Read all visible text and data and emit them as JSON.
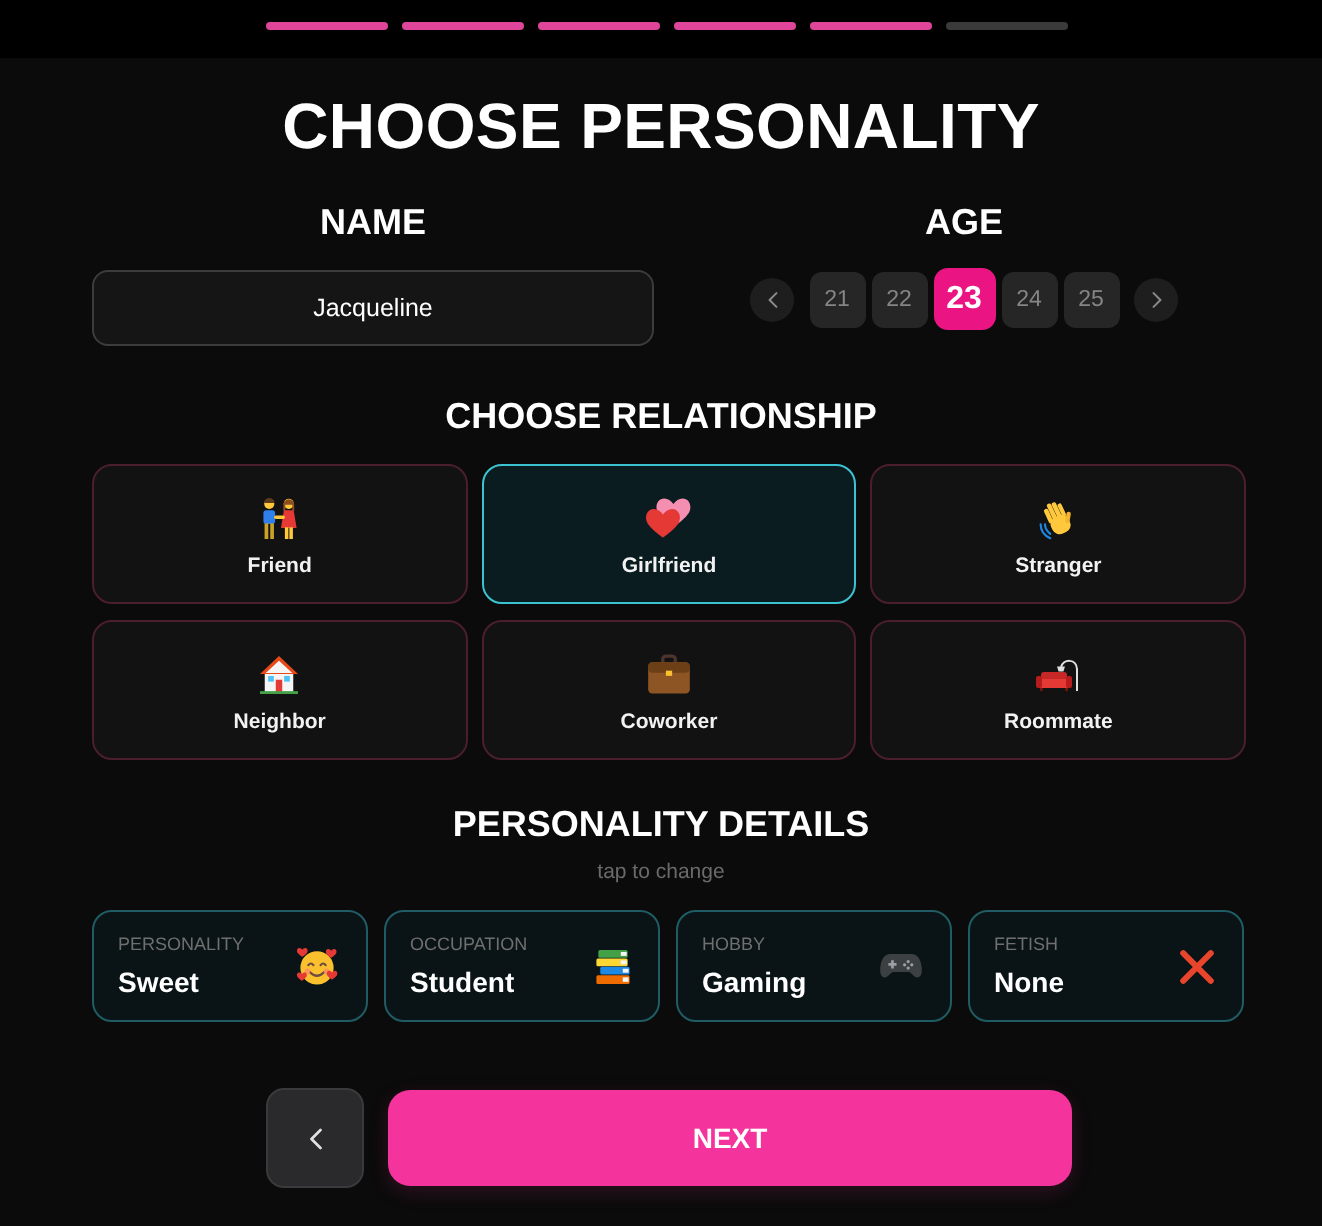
{
  "progress": {
    "steps": [
      {
        "completed": true
      },
      {
        "completed": true
      },
      {
        "completed": true
      },
      {
        "completed": true
      },
      {
        "completed": true
      },
      {
        "completed": false
      }
    ]
  },
  "title": "CHOOSE PERSONALITY",
  "name": {
    "label": "NAME",
    "value": "Jacqueline"
  },
  "age": {
    "label": "AGE",
    "options": [
      {
        "label": "21",
        "selected": false
      },
      {
        "label": "22",
        "selected": false
      },
      {
        "label": "23",
        "selected": true
      },
      {
        "label": "24",
        "selected": false
      },
      {
        "label": "25",
        "selected": false
      }
    ]
  },
  "relationship": {
    "title": "CHOOSE RELATIONSHIP",
    "options": [
      {
        "label": "Friend",
        "selected": false
      },
      {
        "label": "Girlfriend",
        "selected": true
      },
      {
        "label": "Stranger",
        "selected": false
      },
      {
        "label": "Neighbor",
        "selected": false
      },
      {
        "label": "Coworker",
        "selected": false
      },
      {
        "label": "Roommate",
        "selected": false
      }
    ]
  },
  "details": {
    "title": "PERSONALITY DETAILS",
    "hint": "tap to change",
    "items": [
      {
        "label": "PERSONALITY",
        "value": "Sweet"
      },
      {
        "label": "OCCUPATION",
        "value": "Student"
      },
      {
        "label": "HOBBY",
        "value": "Gaming"
      },
      {
        "label": "FETISH",
        "value": "None"
      }
    ]
  },
  "buttons": {
    "next": "NEXT"
  }
}
